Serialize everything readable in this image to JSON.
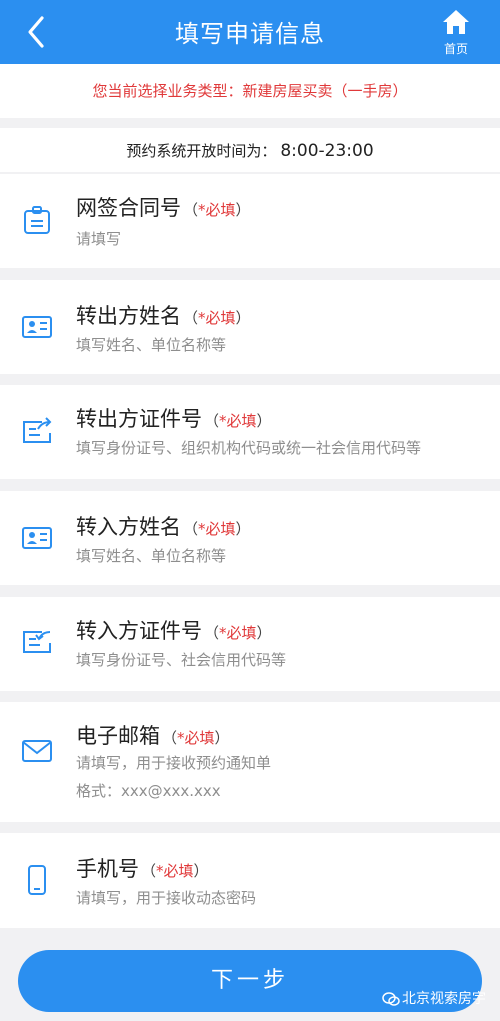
{
  "header": {
    "title": "填写申请信息",
    "home_label": "首页"
  },
  "notice": {
    "text": "您当前选择业务类型：新建房屋买卖（一手房）"
  },
  "hours": {
    "label": "预约系统开放时间为：",
    "time": "8:00-23:00"
  },
  "required_text": "*必填",
  "fields": [
    {
      "label": "网签合同号",
      "hint": "请填写",
      "icon": "id-badge-icon"
    },
    {
      "label": "转出方姓名",
      "hint": "填写姓名、单位名称等",
      "icon": "id-card-icon"
    },
    {
      "label": "转出方证件号",
      "hint": "填写身份证号、组织机构代码或统一社会信用代码等",
      "icon": "card-export-icon"
    },
    {
      "label": "转入方姓名",
      "hint": "填写姓名、单位名称等",
      "icon": "id-card-icon"
    },
    {
      "label": "转入方证件号",
      "hint": "填写身份证号、社会信用代码等",
      "icon": "card-import-icon"
    },
    {
      "label": "电子邮箱",
      "hint": "请填写，用于接收预约通知单",
      "hint2": "格式：xxx@xxx.xxx",
      "icon": "envelope-icon"
    },
    {
      "label": "手机号",
      "hint": "请填写，用于接收动态密码",
      "icon": "phone-icon"
    }
  ],
  "next_button": "下一步",
  "watermark": "北京视索房宇",
  "colors": {
    "primary": "#2b8ff0",
    "notice_red": "#e0393a",
    "background": "#f1f1f3"
  }
}
